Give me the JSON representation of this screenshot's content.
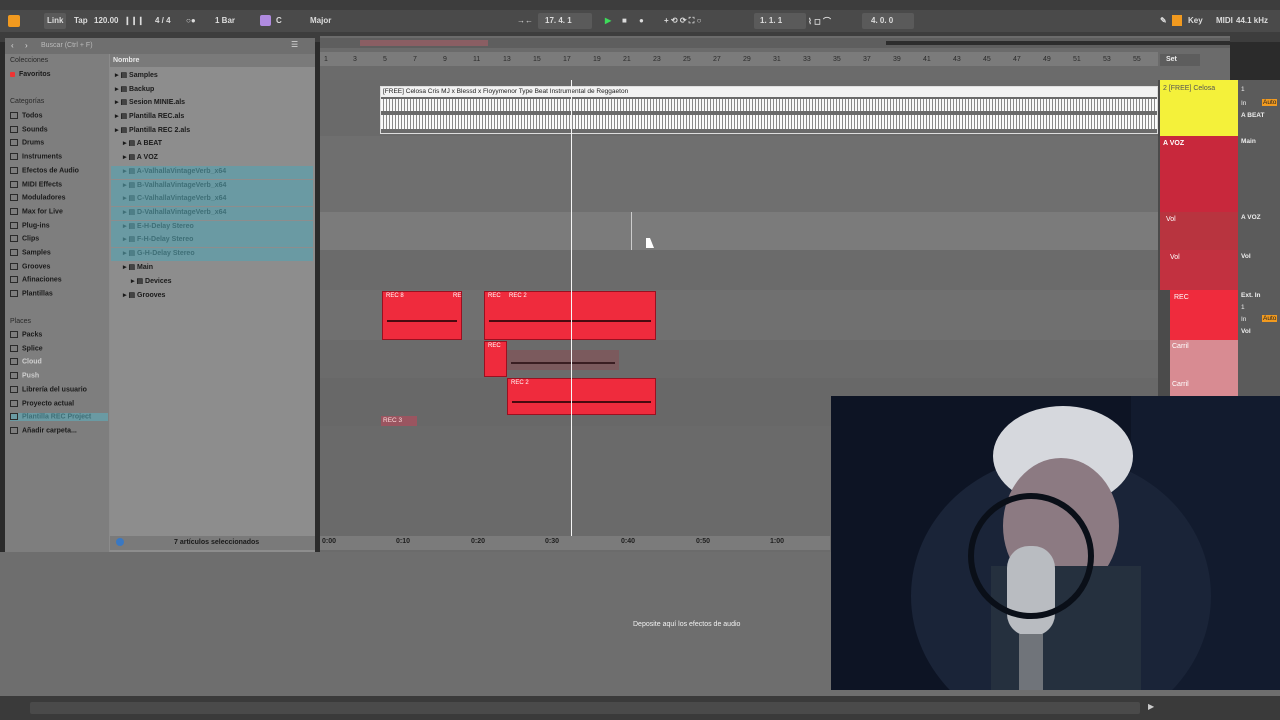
{
  "transport": {
    "link": "Link",
    "tap": "Tap",
    "tempo": "120.00",
    "meter": "4 / 4",
    "quantize": "1 Bar",
    "key": "C",
    "scale": "Major",
    "position": "17.  4.  1",
    "loop_start": "1.  1.  1",
    "loop_length": "4.  0.  0",
    "key_label": "Key",
    "midi_label": "MIDI",
    "sample_rate": "44.1 kHz"
  },
  "browser": {
    "search_placeholder": "Buscar (Ctrl + F)",
    "collections_header": "Colecciones",
    "favorites": "Favoritos",
    "categories_header": "Categorías",
    "categories": [
      "Todos",
      "Sounds",
      "Drums",
      "Instruments",
      "Efectos de Audio",
      "MIDI Effects",
      "Moduladores",
      "Max for Live",
      "Plug-ins",
      "Clips",
      "Samples",
      "Grooves",
      "Afinaciones",
      "Plantillas"
    ],
    "places_header": "Places",
    "places": [
      "Packs",
      "Splice",
      "Cloud",
      "Push",
      "Librería del usuario",
      "Proyecto actual",
      "Plantilla REC Project",
      "Añadir carpeta..."
    ],
    "column_header": "Nombre",
    "items": [
      "Samples",
      "Backup",
      "Sesion MINIE.als",
      "Plantilla REC.als",
      "Plantilla REC 2.als",
      "A BEAT",
      "A VOZ",
      "A-ValhallaVintageVerb_x64",
      "B-ValhallaVintageVerb_x64",
      "C-ValhallaVintageVerb_x64",
      "D-ValhallaVintageVerb_x64",
      "E-H-Delay Stereo",
      "F-H-Delay Stereo",
      "G-H-Delay Stereo",
      "Main",
      "Devices",
      "Grooves"
    ],
    "status": "7 artículos seleccionados"
  },
  "arrangement": {
    "bars": [
      "1",
      "3",
      "5",
      "7",
      "9",
      "11",
      "13",
      "15",
      "17",
      "19",
      "21",
      "23",
      "25",
      "27",
      "29",
      "31",
      "33",
      "35",
      "37",
      "39",
      "41",
      "43",
      "45",
      "47",
      "49",
      "51",
      "53",
      "55"
    ],
    "set_label": "Set",
    "beat_clip_name": "[FREE] Celosa Cris MJ x Blessd x Floyymenor Type Beat  Instrumental de Reggaeton",
    "clips": [
      "REC 8",
      "RE",
      "REC",
      "REC 2",
      "REC",
      "REC 2",
      "REC 3"
    ],
    "time_labels": [
      "0:00",
      "0:10",
      "0:20",
      "0:30",
      "0:40",
      "0:50",
      "1:00"
    ]
  },
  "mixer": {
    "track_names": [
      "2 [FREE] Celosa",
      "A VOZ",
      "Vol",
      "Vol",
      "REC",
      "Carril",
      "Carril"
    ],
    "io": [
      "1",
      "In",
      "Auto",
      "A BEAT",
      "Main",
      "A VOZ",
      "Vol",
      "Ext. In",
      "1",
      "In",
      "Auto",
      "Vol"
    ]
  },
  "devices": {
    "drop_hint": "Deposite aquí los efectos de audio"
  },
  "colors": {
    "clip_red": "#ef2b3d",
    "beat_yellow": "#f4f13a",
    "track_red": "#c8283c",
    "highlight_teal": "#6a9aa3"
  }
}
